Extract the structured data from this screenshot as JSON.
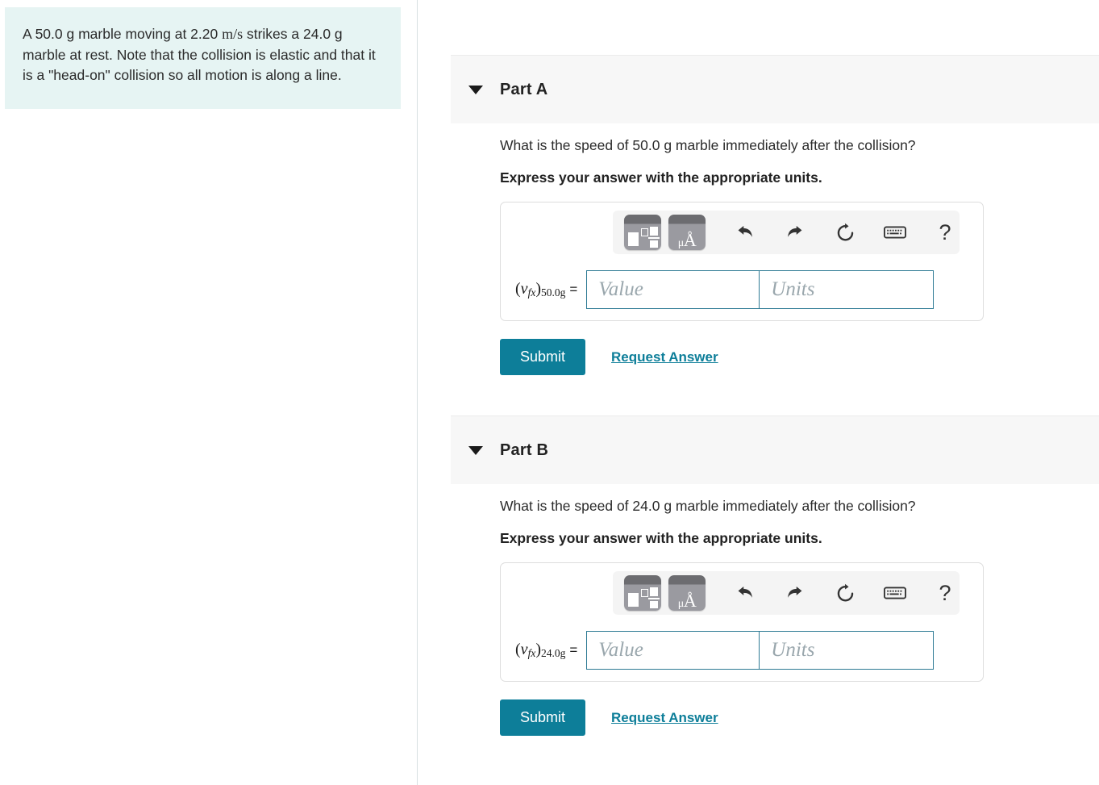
{
  "problem": {
    "segments": [
      {
        "t": "A 50.0 g marble moving at 2.20 ",
        "style": "plain"
      },
      {
        "t": "m/s",
        "style": "math"
      },
      {
        "t": " strikes a 24.0 g marble at rest. Note that the collision is elastic and that it is a \"head-on\" collision so all motion is along a line.",
        "style": "plain"
      }
    ],
    "full_text": "A 50.0 g marble moving at 2.20 m/s strikes a 24.0 g marble at rest. Note that the collision is elastic and that it is a \"head-on\" collision so all motion is along a line.",
    "background_color": "#e6f4f3"
  },
  "toolbar_icons": {
    "template_button": "math-template-palette",
    "units_button": "units-palette",
    "units_glyph_mu": "μ",
    "units_glyph_angstrom": "Å",
    "undo": "undo-icon",
    "redo": "redo-icon",
    "reset": "reset-icon",
    "keyboard": "keyboard-icon",
    "help": "?"
  },
  "common": {
    "instruction": "Express your answer with the appropriate units.",
    "value_placeholder": "Value",
    "units_placeholder": "Units",
    "value_text": "",
    "units_text": "",
    "submit_label": "Submit",
    "request_answer_label": "Request Answer",
    "equals_sign": "=",
    "accent_color": "#0d7e99",
    "field_border_color": "#2d7a94"
  },
  "parts": [
    {
      "id": "a",
      "title": "Part A",
      "question": "What is the speed of 50.0 g marble immediately after the collision?",
      "variable": {
        "symbol": "v",
        "sub": "fx",
        "qualifier": "50.0g"
      }
    },
    {
      "id": "b",
      "title": "Part B",
      "question": "What is the speed of 24.0 g marble immediately after the collision?",
      "variable": {
        "symbol": "v",
        "sub": "fx",
        "qualifier": "24.0g"
      }
    }
  ]
}
